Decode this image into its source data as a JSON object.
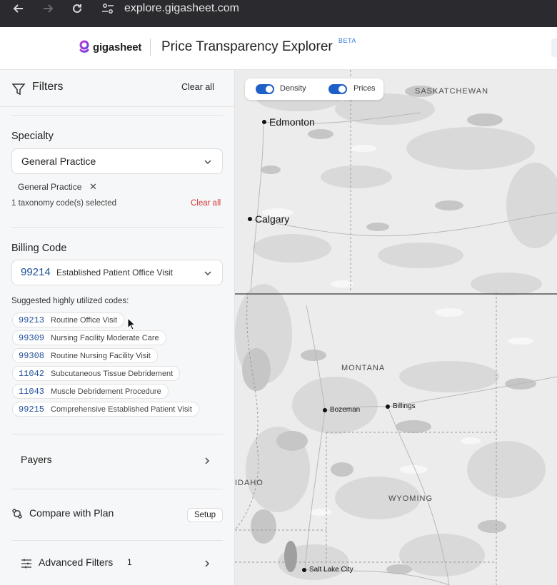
{
  "browser": {
    "url": "explore.gigasheet.com",
    "icons": [
      "back-arrow-icon",
      "forward-arrow-icon",
      "reload-icon",
      "site-settings-icon"
    ]
  },
  "header": {
    "logo_text": "gigasheet",
    "title": "Price Transparency Explorer",
    "badge": "BETA",
    "brand_color": "#8b3fd6"
  },
  "sidebar": {
    "filters_title": "Filters",
    "clear_all": "Clear all",
    "specialty": {
      "label": "Specialty",
      "selected_value": "General Practice",
      "chip": "General Practice",
      "count_text": "1 taxonomy code(s) selected",
      "clear_label": "Clear all"
    },
    "billing": {
      "label": "Billing Code",
      "selected_code": "99214",
      "selected_desc": "Established Patient Office Visit",
      "suggest_label": "Suggested highly utilized codes:",
      "suggestions": [
        {
          "code": "99213",
          "desc": "Routine Office Visit"
        },
        {
          "code": "99309",
          "desc": "Nursing Facility Moderate Care"
        },
        {
          "code": "99308",
          "desc": "Routine Nursing Facility Visit"
        },
        {
          "code": "11042",
          "desc": "Subcutaneous Tissue Debridement"
        },
        {
          "code": "11043",
          "desc": "Muscle Debridement Procedure"
        },
        {
          "code": "99215",
          "desc": "Comprehensive Established Patient Visit"
        }
      ]
    },
    "payers_label": "Payers",
    "compare": {
      "label": "Compare with Plan",
      "button": "Setup"
    },
    "advanced": {
      "label": "Advanced Filters",
      "count": "1"
    }
  },
  "map": {
    "toggles": [
      {
        "label": "Density",
        "on": true
      },
      {
        "label": "Prices",
        "on": true
      }
    ],
    "regions": [
      "SASKATCHEWAN",
      "MONTANA",
      "IDAHO",
      "WYOMING"
    ],
    "cities": [
      "Edmonton",
      "Calgary",
      "Bozeman",
      "Billings",
      "Salt Lake City"
    ],
    "toggle_color": "#1f5fc8"
  }
}
